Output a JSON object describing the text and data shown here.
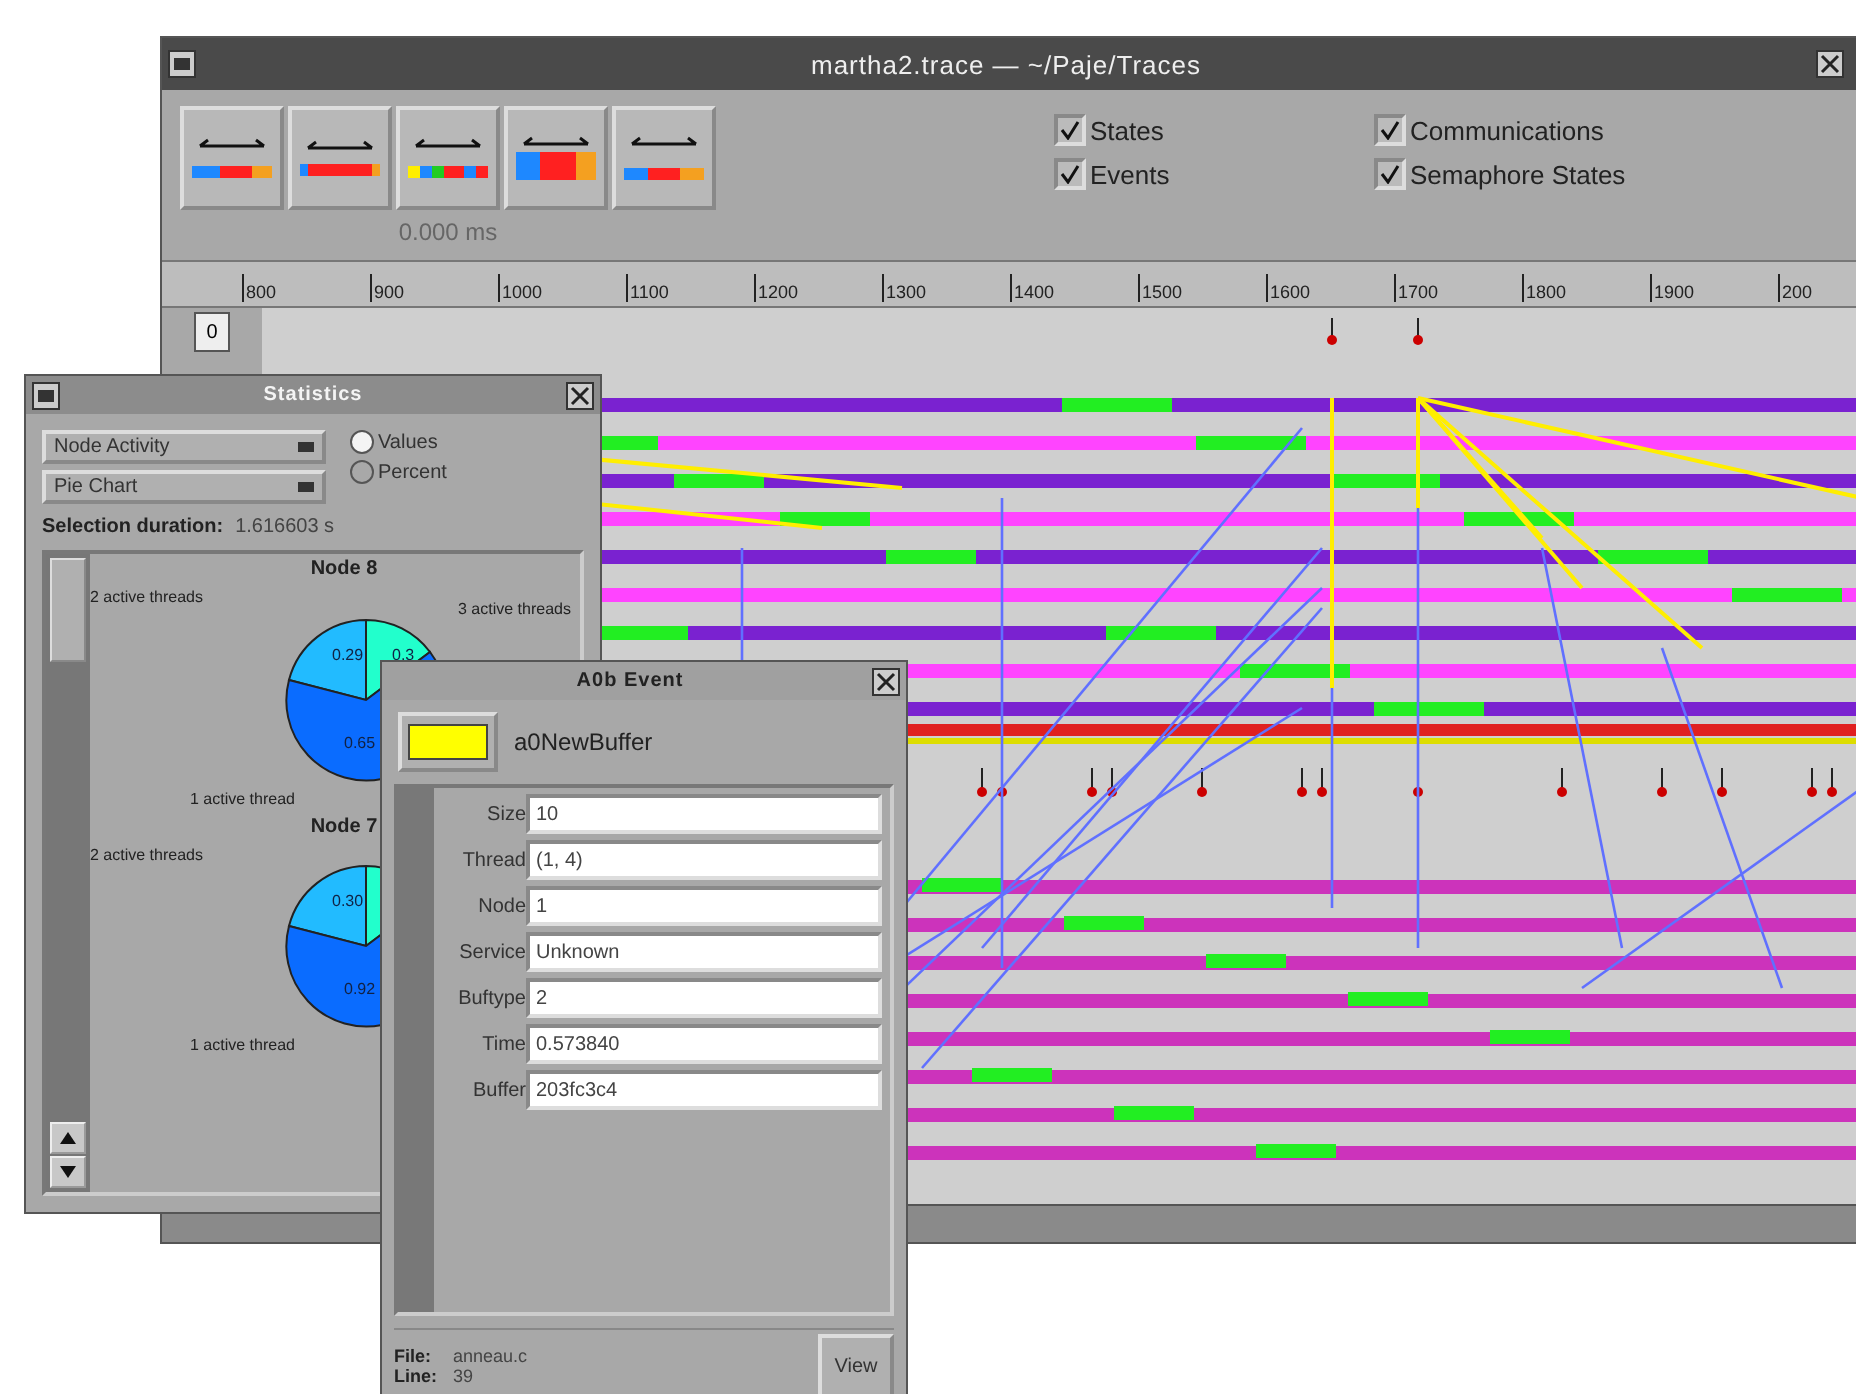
{
  "main_window": {
    "title": "martha2.trace — ~/Paje/Traces",
    "time_display": "0.000 ms",
    "checkboxes": [
      {
        "label": "States",
        "checked": true
      },
      {
        "label": "Events",
        "checked": true
      },
      {
        "label": "Communications",
        "checked": true
      },
      {
        "label": "Semaphore States",
        "checked": true
      }
    ],
    "ruler": [
      "800",
      "900",
      "1000",
      "1100",
      "1200",
      "1300",
      "1400",
      "1500",
      "1600",
      "1700",
      "1800",
      "1900",
      "200"
    ],
    "row_label": "0"
  },
  "statistics_window": {
    "title": "Statistics",
    "dropdowns": [
      "Node Activity",
      "Pie Chart"
    ],
    "radios": [
      {
        "label": "Values",
        "selected": true
      },
      {
        "label": "Percent",
        "selected": false
      }
    ],
    "selection_label": "Selection duration:",
    "selection_value": "1.616603 s",
    "nodes": [
      {
        "title": "Node 8",
        "labels": [
          "2 active threads",
          "3 active threads",
          "1 active thread"
        ],
        "slices": [
          {
            "label": "0.29",
            "color": "#22bbff"
          },
          {
            "label": "0.3",
            "color": "#22ffcc"
          },
          {
            "label": "0.65",
            "color": "#0a6cff"
          }
        ]
      },
      {
        "title": "Node 7",
        "labels": [
          "2 active threads",
          "1 active thread"
        ],
        "slices": [
          {
            "label": "0.30",
            "color": "#22bbff"
          },
          {
            "color": "#22ffcc"
          },
          {
            "label": "0.92",
            "color": "#0a6cff"
          }
        ]
      }
    ]
  },
  "event_window": {
    "title": "A0b Event",
    "color": "#ffff00",
    "name": "a0NewBuffer",
    "fields": [
      {
        "label": "Size",
        "value": "10"
      },
      {
        "label": "Thread",
        "value": "(1, 4)"
      },
      {
        "label": "Node",
        "value": "1"
      },
      {
        "label": "Service",
        "value": "Unknown"
      },
      {
        "label": "Buftype",
        "value": "2"
      },
      {
        "label": "Time",
        "value": "0.573840"
      },
      {
        "label": "Buffer",
        "value": "203fc3c4"
      }
    ],
    "file_label": "File:",
    "file_value": "anneau.c",
    "line_label": "Line:",
    "line_value": "39",
    "view_button": "View"
  }
}
